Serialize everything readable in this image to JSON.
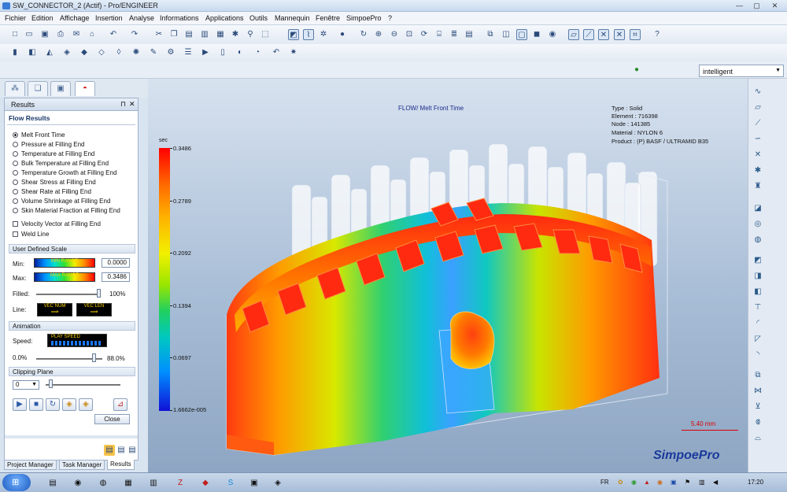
{
  "window": {
    "title": "SW_CONNECTOR_2 (Actif) - Pro/ENGINEER",
    "minimize": "—",
    "maximize": "▢",
    "close": "✕"
  },
  "menu": [
    "Fichier",
    "Edition",
    "Affichage",
    "Insertion",
    "Analyse",
    "Informations",
    "Applications",
    "Outils",
    "Mannequin",
    "Fenêtre",
    "SimpoePro",
    "?"
  ],
  "toolbar": {
    "filter_value": "intelligent"
  },
  "panel": {
    "title": "Results",
    "pin": "⊓",
    "close": "✕",
    "section_title": "Flow Results",
    "results": [
      {
        "label": "Melt Front Time",
        "selected": true
      },
      {
        "label": "Pressure at Filling End",
        "selected": false
      },
      {
        "label": "Temperature at Filling End",
        "selected": false
      },
      {
        "label": "Bulk Temperature at Filling End",
        "selected": false
      },
      {
        "label": "Temperature Growth at Filling End",
        "selected": false
      },
      {
        "label": "Shear Stress at Filling End",
        "selected": false
      },
      {
        "label": "Shear Rate at Filling End",
        "selected": false
      },
      {
        "label": "Volume Shrinkage at Filling End",
        "selected": false
      },
      {
        "label": "Skin Material Fraction at Filling End",
        "selected": false
      }
    ],
    "checks": [
      {
        "label": "Velocity Vector at Filling End",
        "checked": false
      },
      {
        "label": "Weld Line",
        "checked": false
      }
    ],
    "scale": {
      "header": "User Defined Scale",
      "min_label": "Min:",
      "min_range": "MIN RANGE",
      "min_value": "0.0000",
      "max_label": "Max:",
      "max_range": "MAX RANGE",
      "max_value": "0.3486",
      "filled_label": "Filled:",
      "filled_value": "100%",
      "filled_fraction": 1.0,
      "line_label": "Line:",
      "vec_num": "VEC NUM",
      "vec_len": "VEC LEN"
    },
    "animation": {
      "header": "Animation",
      "speed_label": "Speed:",
      "play_speed": "PLAY SPEED",
      "progress_start": "0.0%",
      "progress_value": "88.0%",
      "progress_fraction": 0.88
    },
    "clipping": {
      "header": "Clipping Plane",
      "value": "0"
    },
    "close_label": "Close"
  },
  "bottom_tabs": [
    {
      "label": "Project Manager",
      "active": false
    },
    {
      "label": "Task Manager",
      "active": false
    },
    {
      "label": "Results",
      "active": true
    }
  ],
  "viewport": {
    "title": "FLOW/ Melt Front Time",
    "info": [
      "Type : Solid",
      "Element : 716398",
      "Node : 141385",
      "Material : NYLON 6",
      "Product :  (P)  BASF / ULTRAMID B35"
    ],
    "legend_unit": "sec",
    "legend_values": [
      "0.3486",
      "0.2789",
      "0.2092",
      "0.1394",
      "0.0697",
      "1.6662e-005"
    ],
    "scale_label": "5.40 mm",
    "brand": "SimpoePro"
  },
  "taskbar": {
    "lang": "FR",
    "time": "17:20"
  },
  "colors": {
    "accent": "#1a3a9a",
    "hot": "#ff2000",
    "cold": "#1010d8"
  }
}
